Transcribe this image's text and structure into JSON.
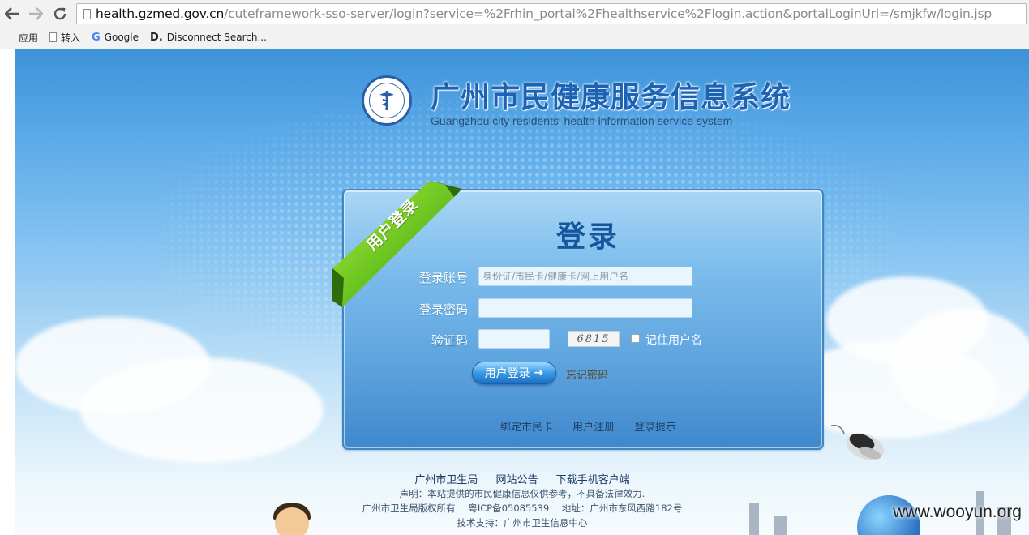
{
  "browser": {
    "url_host": "health.gzmed.gov.cn",
    "url_path": "/cuteframework-sso-server/login?service=%2Frhin_portal%2Fhealthservice%2Flogin.action&portalLoginUrl=/smjkfw/login.jsp",
    "bookmarks": [
      {
        "icon": "apps-icon",
        "label": "应用"
      },
      {
        "icon": "document-icon",
        "label": "转入"
      },
      {
        "icon": "google-icon",
        "label": "Google"
      },
      {
        "icon": "disconnect-icon",
        "label": "Disconnect Search..."
      }
    ]
  },
  "header": {
    "title_cn": "广州市民健康服务信息系统",
    "title_en": "Guangzhou city residents' health information service system"
  },
  "login": {
    "ribbon": "用户登录",
    "title": "登录",
    "account_label": "登录账号",
    "account_placeholder": "身份证/市民卡/健康卡/网上用户名",
    "password_label": "登录密码",
    "captcha_label": "验证码",
    "captcha_image_text": "6815",
    "remember_label": "记住用户名",
    "remember_checked": false,
    "login_button": "用户登录",
    "forgot_link": "忘记密码",
    "bottom_links": [
      "绑定市民卡",
      "用户注册",
      "登录提示"
    ]
  },
  "footer": {
    "links": [
      "广州市卫生局",
      "网站公告",
      "下载手机客户端"
    ],
    "statement": "声明：本站提供的市民健康信息仅供参考，不具备法律效力.",
    "copyright": "广州市卫生局版权所有",
    "icp": "粤ICP备05085539",
    "address": "地址：广州市东风西路182号",
    "tech_support": "技术支持：广州市卫生信息中心"
  },
  "watermark": "www.wooyun.org",
  "colors": {
    "title_blue": "#1c62b5",
    "panel_blue": "#5fa5df",
    "ribbon_green": "#5fb81c"
  }
}
